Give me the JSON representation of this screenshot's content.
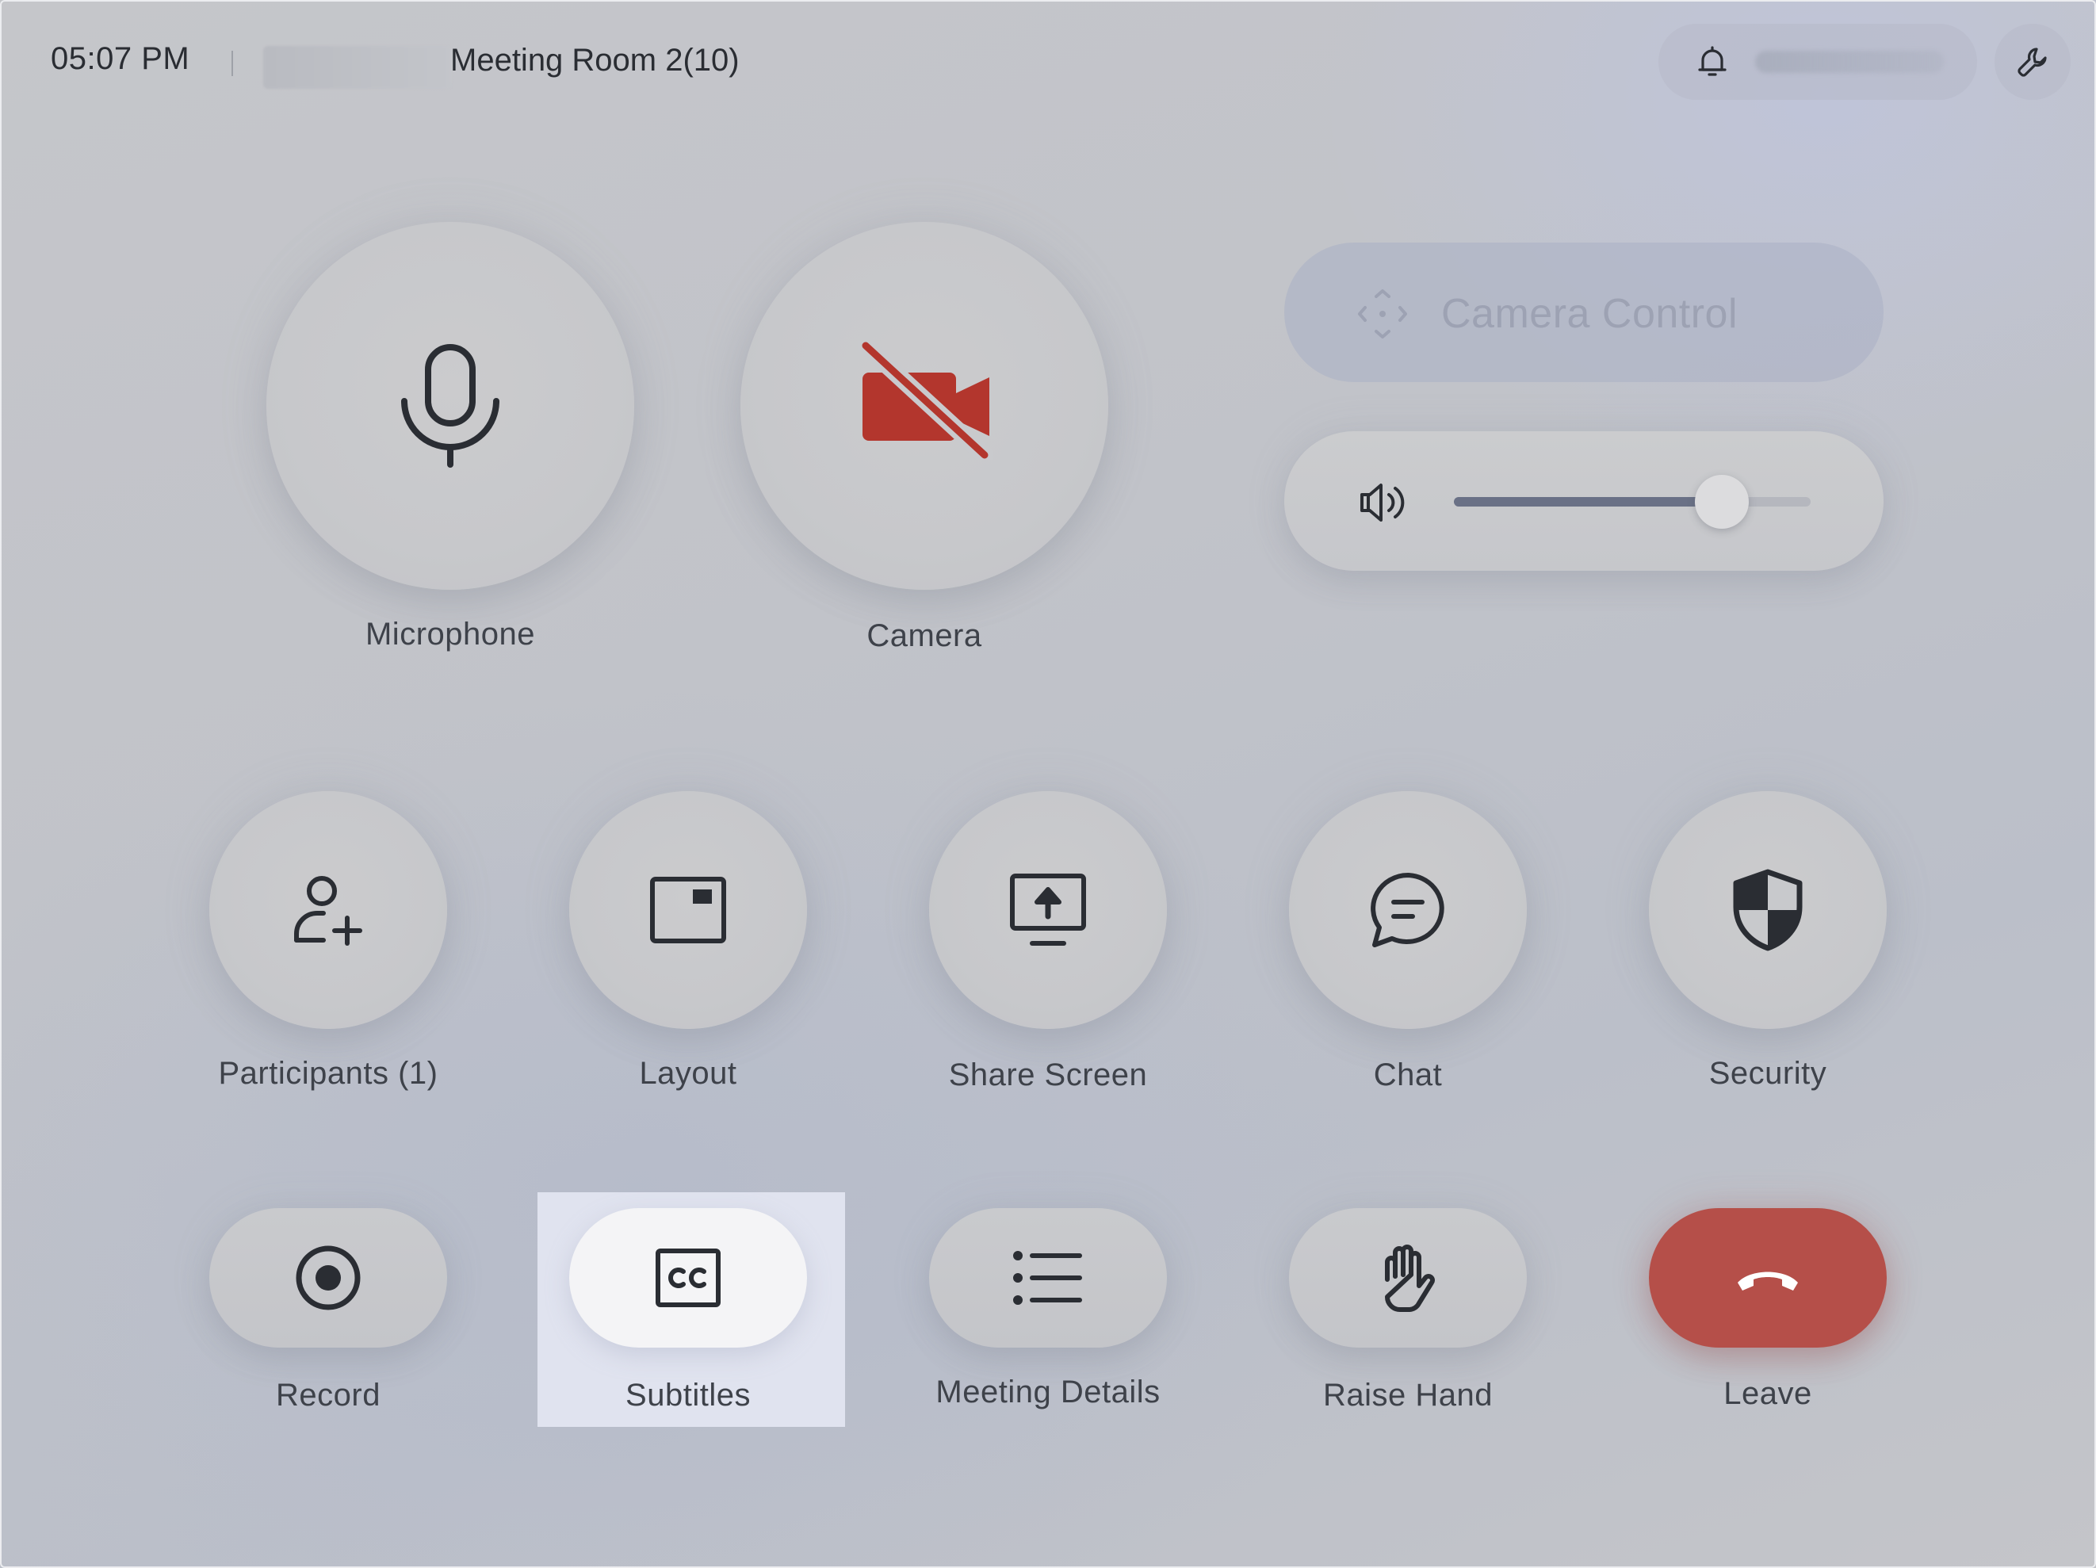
{
  "header": {
    "time": "05:07 PM",
    "room_title": "Meeting Room 2(10)"
  },
  "main_controls": {
    "microphone_label": "Microphone",
    "camera_label": "Camera",
    "camera_state": "off"
  },
  "camera_control": {
    "label": "Camera Control",
    "enabled": false
  },
  "volume": {
    "level": 0.75
  },
  "actions": {
    "participants_label": "Participants (1)",
    "layout_label": "Layout",
    "share_screen_label": "Share Screen",
    "chat_label": "Chat",
    "security_label": "Security",
    "record_label": "Record",
    "subtitles_label": "Subtitles",
    "meeting_details_label": "Meeting Details",
    "raise_hand_label": "Raise Hand",
    "leave_label": "Leave"
  },
  "colors": {
    "camera_off_red": "#b3362d",
    "leave_red": "#b54f49",
    "slider_fill": "#6a7186"
  },
  "icons": {
    "bell": "bell-icon",
    "settings": "wrench-icon",
    "microphone": "microphone-icon",
    "camera": "camera-off-icon",
    "camera_control": "move-arrows-icon",
    "volume": "speaker-icon",
    "participants": "add-person-icon",
    "layout": "layout-icon",
    "share_screen": "share-screen-icon",
    "chat": "chat-bubble-icon",
    "security": "shield-icon",
    "record": "record-icon",
    "subtitles": "cc-icon",
    "meeting_details": "list-icon",
    "raise_hand": "hand-icon",
    "leave": "hang-up-icon"
  }
}
